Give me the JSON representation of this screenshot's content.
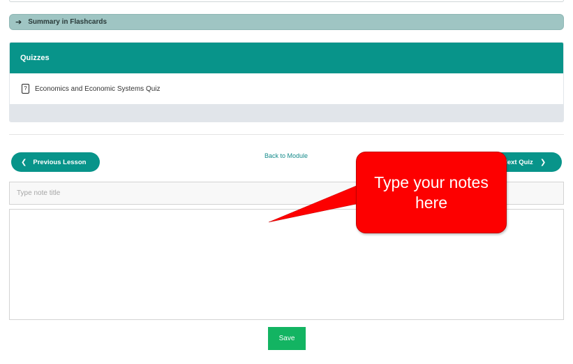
{
  "flashcards": {
    "label": "Summary in Flashcards",
    "icon": "arrow-right-icon"
  },
  "quizzes": {
    "header": "Quizzes",
    "items": [
      {
        "title": "Economics and Economic Systems Quiz",
        "icon": "quiz-icon"
      }
    ]
  },
  "nav": {
    "prev_label": "Previous Lesson",
    "back_label": "Back to Module",
    "next_label": "Next Quiz"
  },
  "notes": {
    "title_placeholder": "Type note title",
    "body_value": "",
    "save_label": "Save"
  },
  "callout": {
    "text": "Type your notes here"
  },
  "colors": {
    "accent": "#08948a",
    "flashcards_bar": "#9fc5c3",
    "save": "#13b462",
    "callout": "#fd0000"
  }
}
